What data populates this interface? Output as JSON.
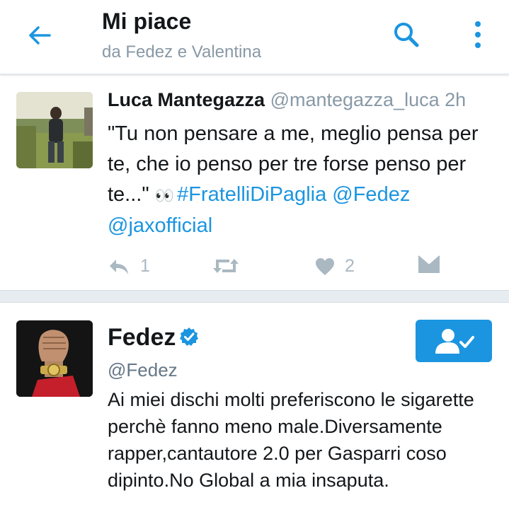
{
  "header": {
    "title": "Mi piace",
    "subtitle": "da Fedez e Valentina",
    "icons": [
      "back-arrow-icon",
      "search-icon",
      "more-vertical-icon"
    ],
    "accent_color": "#1b95e0"
  },
  "tweet": {
    "author_name": "Luca Mantegazza",
    "author_handle": "@mantegazza_luca",
    "time": "2h",
    "text_plain": "\"Tu non pensare a me, meglio pensa per te, che io penso per tre forse penso per te...\"",
    "emoji": "👀",
    "hashtag": "#FratelliDiPaglia",
    "mention_1": "@Fedez",
    "mention_2": "@jaxofficial",
    "actions": {
      "reply_count": "1",
      "like_count": "2"
    }
  },
  "user_card": {
    "name": "Fedez",
    "handle": "@Fedez",
    "bio": "Ai miei dischi molti preferiscono le sigarette perchè fanno meno male.Diversamente rapper,cantautore 2.0 per Gasparri coso dipinto.No Global a mia insaputa.",
    "verified": true,
    "following": true
  }
}
